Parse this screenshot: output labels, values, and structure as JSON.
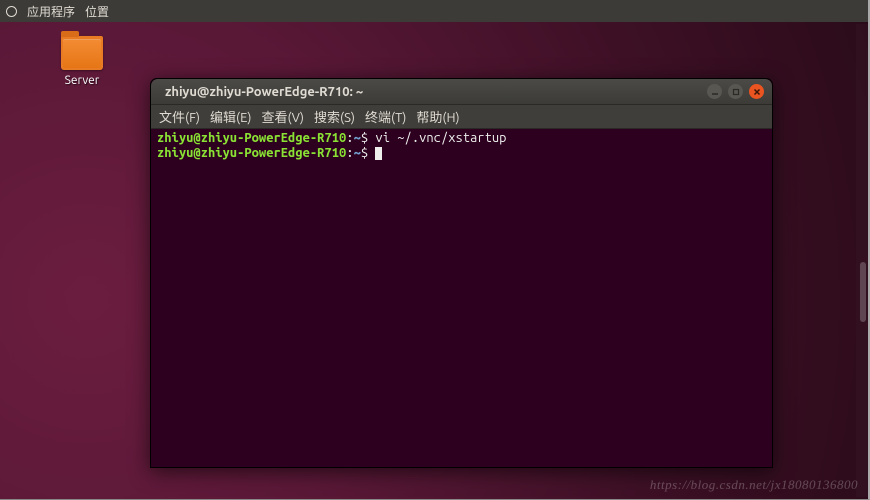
{
  "panel": {
    "applications": "应用程序",
    "places": "位置"
  },
  "desktop": {
    "folder_label": "Server"
  },
  "terminal": {
    "title": "zhiyu@zhiyu-PowerEdge-R710: ~",
    "menus": {
      "file": "文件(F)",
      "edit": "编辑(E)",
      "view": "查看(V)",
      "search": "搜索(S)",
      "terminal": "终端(T)",
      "help": "帮助(H)"
    },
    "prompt": {
      "user": "zhiyu",
      "at": "@",
      "host": "zhiyu-PowerEdge-R710",
      "colon": ":",
      "path": "~",
      "sigil": "$"
    },
    "lines": [
      {
        "command": "vi ~/.vnc/xstartup"
      },
      {
        "command": ""
      }
    ]
  },
  "watermark": "https://blog.csdn.net/jx18080136800"
}
